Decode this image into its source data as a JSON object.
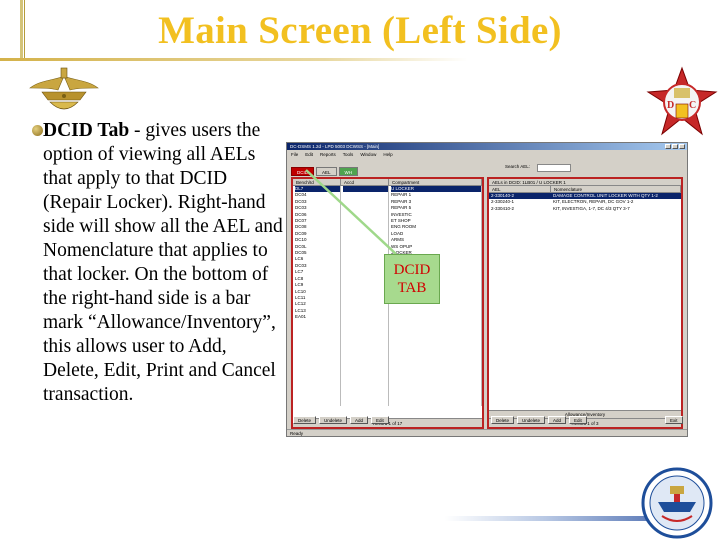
{
  "title": "Main Screen (Left Side)",
  "body": {
    "bold_lead": "DCID Tab",
    "text": " - gives users the option of viewing all AELs that apply to that DCID (Repair Locker). Right-hand side will show all the AEL and Nomenclature that applies to that locker.  On the bottom of the right-hand side is a bar mark “Allowance/Inventory”, this allows user to Add, Delete, Edit, Print and Cancel transaction."
  },
  "callout": {
    "line1": "DCID",
    "line2": "TAB"
  },
  "colors": {
    "title": "#f2c020",
    "callout_bg": "#a7da8e",
    "callout_text": "#d10000",
    "tab_active": "#c00000",
    "panel_border": "#b22222"
  },
  "app": {
    "title": "DC-DSMS 1.2d - LPD 5003 DCWSS - [Main]",
    "menu": [
      "File",
      "Edit",
      "Reports",
      "Tools",
      "Window",
      "Help"
    ],
    "search_label": "Search AEL:",
    "tabs": {
      "dcid": "DCID",
      "ael": "AEL",
      "wh": "WH"
    },
    "left_headers": [
      "Bench/Id",
      "Accd",
      "Compartment"
    ],
    "left_col1": [
      "DL7",
      "DC04",
      "DC03",
      "DC03",
      "DC06",
      "DC07",
      "DC08",
      "DC09",
      "DC10",
      "DC0L",
      "DC05",
      "LC6",
      "DC03",
      "LC7",
      "LC8",
      "LC9",
      "LC10",
      "LC11",
      "LC12",
      "LC13",
      "EA01"
    ],
    "left_col3": [
      "U LOCKER",
      "REPAIR 1",
      "REPAIR 3",
      "REPAIR 5",
      "INVESTIC",
      "ET SHOP",
      "ENG ROOM",
      "LOAD",
      "ARMS",
      "WS OPUP",
      "JLOCKER",
      "MEDICAL",
      "BOAT 1",
      "BOAT 2",
      "REPAIR 1",
      "REPAIR 2"
    ],
    "left_selected_row": 0,
    "left_record": "Record 1 of 17",
    "right_title": "AELs in DCID: 1LB01 / U LOCKER 1",
    "right_headers": [
      "AEL",
      "Nomenclature"
    ],
    "right_rows": [
      [
        "2-330140-2",
        "DAMAGE CONTROL UNIT LOCKER WITH QTY 1-2"
      ],
      [
        "2-330240-1",
        "KIT, ELECTRON, REPAIR, DC GOV 1-2"
      ],
      [
        "2-330410-2",
        "KIT, INVESTIGA, 1-7, DC 4/3 QTY 3-7"
      ]
    ],
    "right_selected_row": 0,
    "allowance_label": "Allowance/Inventory",
    "right_record": "Record 1 of 3",
    "left_buttons": [
      "Delete",
      "Undelete",
      "Add",
      "Edit"
    ],
    "right_buttons": [
      "Delete",
      "Undelete",
      "Add",
      "Edit"
    ],
    "exit_button": "Exit",
    "status": "Ready"
  }
}
